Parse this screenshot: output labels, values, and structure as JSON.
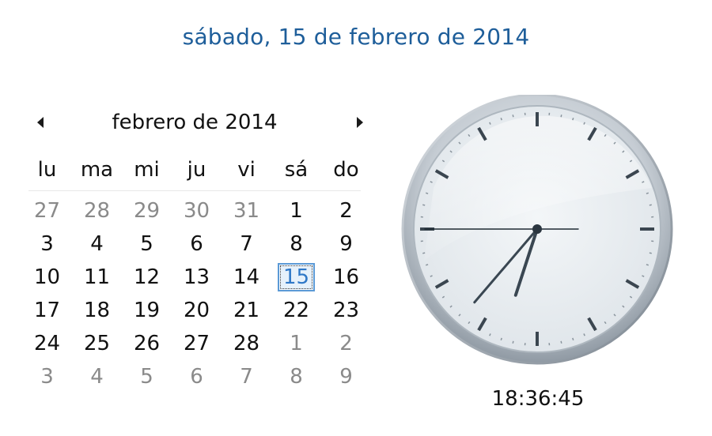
{
  "long_date": "sábado, 15 de febrero de 2014",
  "calendar": {
    "month_label": "febrero de 2014",
    "weekdays": [
      "lu",
      "ma",
      "mi",
      "ju",
      "vi",
      "sá",
      "do"
    ],
    "selected_day": 15,
    "weeks": [
      [
        {
          "d": "27",
          "o": true
        },
        {
          "d": "28",
          "o": true
        },
        {
          "d": "29",
          "o": true
        },
        {
          "d": "30",
          "o": true
        },
        {
          "d": "31",
          "o": true
        },
        {
          "d": "1"
        },
        {
          "d": "2"
        }
      ],
      [
        {
          "d": "3"
        },
        {
          "d": "4"
        },
        {
          "d": "5"
        },
        {
          "d": "6"
        },
        {
          "d": "7"
        },
        {
          "d": "8"
        },
        {
          "d": "9"
        }
      ],
      [
        {
          "d": "10"
        },
        {
          "d": "11"
        },
        {
          "d": "12"
        },
        {
          "d": "13"
        },
        {
          "d": "14"
        },
        {
          "d": "15",
          "t": true
        },
        {
          "d": "16"
        }
      ],
      [
        {
          "d": "17"
        },
        {
          "d": "18"
        },
        {
          "d": "19"
        },
        {
          "d": "20"
        },
        {
          "d": "21"
        },
        {
          "d": "22"
        },
        {
          "d": "23"
        }
      ],
      [
        {
          "d": "24"
        },
        {
          "d": "25"
        },
        {
          "d": "26"
        },
        {
          "d": "27"
        },
        {
          "d": "28"
        },
        {
          "d": "1",
          "o": true
        },
        {
          "d": "2",
          "o": true
        }
      ],
      [
        {
          "d": "3",
          "o": true
        },
        {
          "d": "4",
          "o": true
        },
        {
          "d": "5",
          "o": true
        },
        {
          "d": "6",
          "o": true
        },
        {
          "d": "7",
          "o": true
        },
        {
          "d": "8",
          "o": true
        },
        {
          "d": "9",
          "o": true
        }
      ]
    ]
  },
  "clock": {
    "time": "18:36:45",
    "hour": 18,
    "minute": 36,
    "second": 45
  },
  "icons": {
    "prev": "chevron-left-icon",
    "next": "chevron-right-icon"
  },
  "colors": {
    "heading": "#1e5e9a",
    "today_border": "#5b9ad6",
    "today_text": "#2f78c7",
    "other_month_text": "#8a8a8a"
  }
}
